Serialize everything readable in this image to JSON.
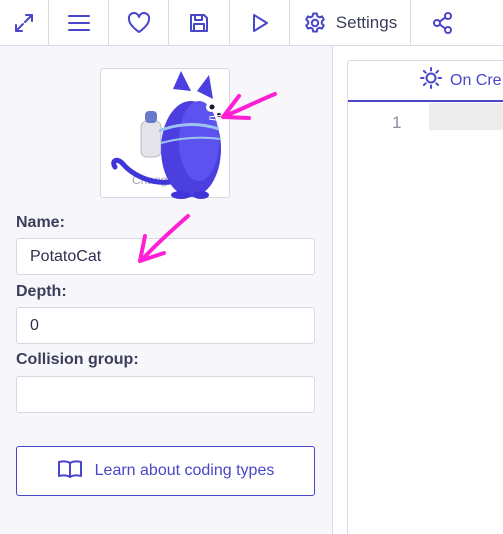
{
  "toolbar": {
    "fullscreen_icon": "expand-arrows-icon",
    "menu_icon": "hamburger-icon",
    "favorite_icon": "heart-icon",
    "save_icon": "floppy-disk-icon",
    "run_icon": "play-icon",
    "settings_label": "Settings",
    "settings_icon": "gear-icon",
    "share_icon": "share-nodes-icon"
  },
  "texture": {
    "change_label": "Change ture"
  },
  "form": {
    "name_label": "Name:",
    "name_value": "PotatoCat",
    "depth_label": "Depth:",
    "depth_value": "0",
    "collision_label": "Collision group:",
    "collision_value": ""
  },
  "learn_button": {
    "label": "Learn about coding types",
    "icon": "book-icon"
  },
  "editor": {
    "tab_label": "On Cre",
    "tab_icon": "sun-icon",
    "line_number": "1"
  },
  "annotations": {
    "arrow_color": "#ff1fd4"
  },
  "colors": {
    "accent": "#4a46c9",
    "panel_bg": "#f7f7fb",
    "cat_body": "#4b3fe0"
  }
}
